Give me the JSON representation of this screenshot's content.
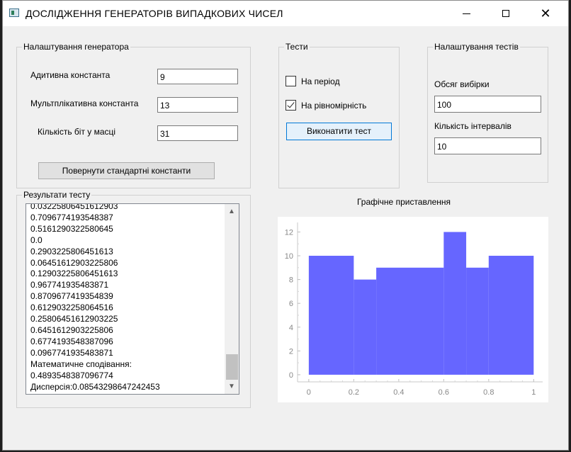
{
  "window": {
    "title": "ДОСЛІДЖЕННЯ ГЕНЕРАТОРІВ ВИПАДКОВИХ ЧИСЕЛ",
    "icons": [
      "app-icon",
      "minimize-icon",
      "maximize-icon",
      "close-icon"
    ]
  },
  "generator": {
    "group_label": "Налаштування генератора",
    "additive_label": "Адитивна константа",
    "additive_value": "9",
    "multiplicative_label": "Мультплікативна константа",
    "multiplicative_value": "13",
    "bits_label": "Кількість біт у масці",
    "bits_value": "31",
    "reset_button": "Повернути стандартні константи"
  },
  "tests": {
    "group_label": "Тести",
    "period_label": "На період",
    "period_checked": false,
    "uniform_label": "На рівномірність",
    "uniform_checked": true,
    "run_button": "Виконатити тест"
  },
  "test_settings": {
    "group_label": "Налаштування тестів",
    "sample_label": "Обсяг вибірки",
    "sample_value": "100",
    "intervals_label": "Кількість інтервалів",
    "intervals_value": "10"
  },
  "results": {
    "group_label": "Результати тесту",
    "lines": [
      "0.03225806451612903",
      "0.7096774193548387",
      "0.5161290322580645",
      "0.0",
      "0.2903225806451613",
      "0.06451612903225806",
      "0.12903225806451613",
      "0.967741935483871",
      "0.8709677419354839",
      "0.6129032258064516",
      "0.25806451612903225",
      "0.6451612903225806",
      "0.6774193548387096",
      "0.0967741935483871",
      "Математичне сподівання:",
      "0.4893548387096774",
      "Дисперсія:0.08543298647242453"
    ]
  },
  "chart_title": "Графічне приставлення",
  "chart_data": {
    "type": "bar",
    "bins": [
      [
        0,
        0.2
      ],
      [
        0.2,
        0.3
      ],
      [
        0.3,
        0.6
      ],
      [
        0.6,
        0.7
      ],
      [
        0.7,
        0.8
      ],
      [
        0.8,
        1.0
      ]
    ],
    "values": [
      10,
      8,
      9,
      12,
      9,
      10
    ],
    "x_ticks": [
      0,
      0.2,
      0.4,
      0.6,
      0.8,
      1
    ],
    "x_tick_labels": [
      "0",
      "0.2",
      "0.4",
      "0.6",
      "0.8",
      "1"
    ],
    "y_ticks": [
      0,
      2,
      4,
      6,
      8,
      10,
      12
    ],
    "y_tick_labels": [
      "0",
      "2",
      "4",
      "6",
      "8",
      "10",
      "12"
    ],
    "xlim": [
      -0.05,
      1.04
    ],
    "ylim": [
      -0.6,
      12.8
    ],
    "bar_color": "#6666ff",
    "grid": false
  }
}
